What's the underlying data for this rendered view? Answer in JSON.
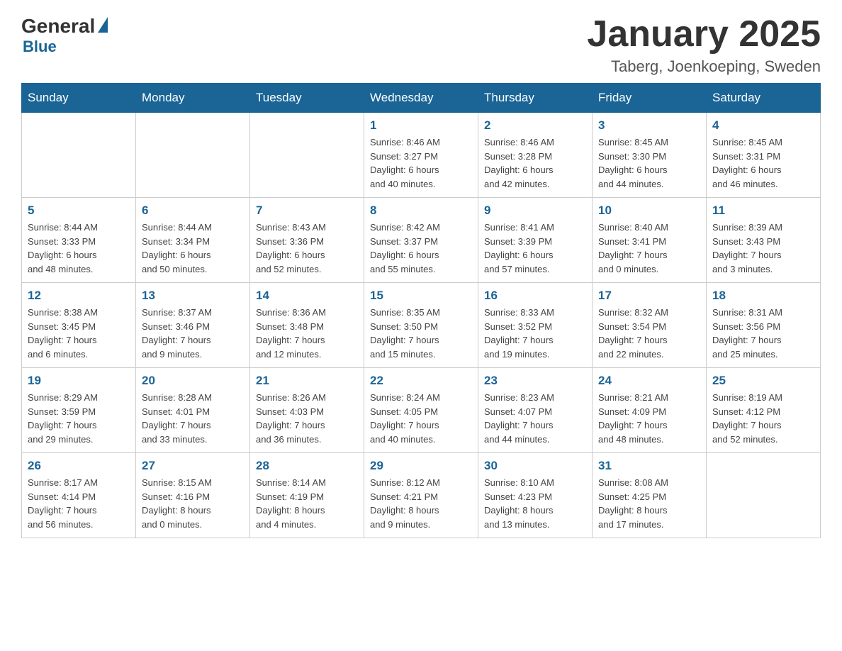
{
  "header": {
    "logo": {
      "general": "General",
      "blue": "Blue"
    },
    "title": "January 2025",
    "location": "Taberg, Joenkoeping, Sweden"
  },
  "days_of_week": [
    "Sunday",
    "Monday",
    "Tuesday",
    "Wednesday",
    "Thursday",
    "Friday",
    "Saturday"
  ],
  "weeks": [
    [
      {
        "day": "",
        "info": ""
      },
      {
        "day": "",
        "info": ""
      },
      {
        "day": "",
        "info": ""
      },
      {
        "day": "1",
        "info": "Sunrise: 8:46 AM\nSunset: 3:27 PM\nDaylight: 6 hours\nand 40 minutes."
      },
      {
        "day": "2",
        "info": "Sunrise: 8:46 AM\nSunset: 3:28 PM\nDaylight: 6 hours\nand 42 minutes."
      },
      {
        "day": "3",
        "info": "Sunrise: 8:45 AM\nSunset: 3:30 PM\nDaylight: 6 hours\nand 44 minutes."
      },
      {
        "day": "4",
        "info": "Sunrise: 8:45 AM\nSunset: 3:31 PM\nDaylight: 6 hours\nand 46 minutes."
      }
    ],
    [
      {
        "day": "5",
        "info": "Sunrise: 8:44 AM\nSunset: 3:33 PM\nDaylight: 6 hours\nand 48 minutes."
      },
      {
        "day": "6",
        "info": "Sunrise: 8:44 AM\nSunset: 3:34 PM\nDaylight: 6 hours\nand 50 minutes."
      },
      {
        "day": "7",
        "info": "Sunrise: 8:43 AM\nSunset: 3:36 PM\nDaylight: 6 hours\nand 52 minutes."
      },
      {
        "day": "8",
        "info": "Sunrise: 8:42 AM\nSunset: 3:37 PM\nDaylight: 6 hours\nand 55 minutes."
      },
      {
        "day": "9",
        "info": "Sunrise: 8:41 AM\nSunset: 3:39 PM\nDaylight: 6 hours\nand 57 minutes."
      },
      {
        "day": "10",
        "info": "Sunrise: 8:40 AM\nSunset: 3:41 PM\nDaylight: 7 hours\nand 0 minutes."
      },
      {
        "day": "11",
        "info": "Sunrise: 8:39 AM\nSunset: 3:43 PM\nDaylight: 7 hours\nand 3 minutes."
      }
    ],
    [
      {
        "day": "12",
        "info": "Sunrise: 8:38 AM\nSunset: 3:45 PM\nDaylight: 7 hours\nand 6 minutes."
      },
      {
        "day": "13",
        "info": "Sunrise: 8:37 AM\nSunset: 3:46 PM\nDaylight: 7 hours\nand 9 minutes."
      },
      {
        "day": "14",
        "info": "Sunrise: 8:36 AM\nSunset: 3:48 PM\nDaylight: 7 hours\nand 12 minutes."
      },
      {
        "day": "15",
        "info": "Sunrise: 8:35 AM\nSunset: 3:50 PM\nDaylight: 7 hours\nand 15 minutes."
      },
      {
        "day": "16",
        "info": "Sunrise: 8:33 AM\nSunset: 3:52 PM\nDaylight: 7 hours\nand 19 minutes."
      },
      {
        "day": "17",
        "info": "Sunrise: 8:32 AM\nSunset: 3:54 PM\nDaylight: 7 hours\nand 22 minutes."
      },
      {
        "day": "18",
        "info": "Sunrise: 8:31 AM\nSunset: 3:56 PM\nDaylight: 7 hours\nand 25 minutes."
      }
    ],
    [
      {
        "day": "19",
        "info": "Sunrise: 8:29 AM\nSunset: 3:59 PM\nDaylight: 7 hours\nand 29 minutes."
      },
      {
        "day": "20",
        "info": "Sunrise: 8:28 AM\nSunset: 4:01 PM\nDaylight: 7 hours\nand 33 minutes."
      },
      {
        "day": "21",
        "info": "Sunrise: 8:26 AM\nSunset: 4:03 PM\nDaylight: 7 hours\nand 36 minutes."
      },
      {
        "day": "22",
        "info": "Sunrise: 8:24 AM\nSunset: 4:05 PM\nDaylight: 7 hours\nand 40 minutes."
      },
      {
        "day": "23",
        "info": "Sunrise: 8:23 AM\nSunset: 4:07 PM\nDaylight: 7 hours\nand 44 minutes."
      },
      {
        "day": "24",
        "info": "Sunrise: 8:21 AM\nSunset: 4:09 PM\nDaylight: 7 hours\nand 48 minutes."
      },
      {
        "day": "25",
        "info": "Sunrise: 8:19 AM\nSunset: 4:12 PM\nDaylight: 7 hours\nand 52 minutes."
      }
    ],
    [
      {
        "day": "26",
        "info": "Sunrise: 8:17 AM\nSunset: 4:14 PM\nDaylight: 7 hours\nand 56 minutes."
      },
      {
        "day": "27",
        "info": "Sunrise: 8:15 AM\nSunset: 4:16 PM\nDaylight: 8 hours\nand 0 minutes."
      },
      {
        "day": "28",
        "info": "Sunrise: 8:14 AM\nSunset: 4:19 PM\nDaylight: 8 hours\nand 4 minutes."
      },
      {
        "day": "29",
        "info": "Sunrise: 8:12 AM\nSunset: 4:21 PM\nDaylight: 8 hours\nand 9 minutes."
      },
      {
        "day": "30",
        "info": "Sunrise: 8:10 AM\nSunset: 4:23 PM\nDaylight: 8 hours\nand 13 minutes."
      },
      {
        "day": "31",
        "info": "Sunrise: 8:08 AM\nSunset: 4:25 PM\nDaylight: 8 hours\nand 17 minutes."
      },
      {
        "day": "",
        "info": ""
      }
    ]
  ]
}
